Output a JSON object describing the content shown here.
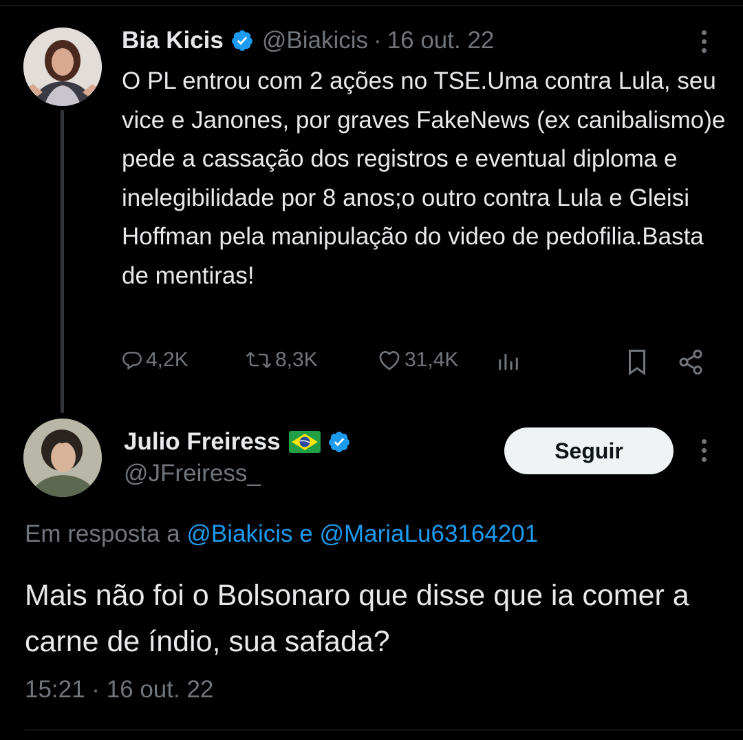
{
  "tweet": {
    "author": {
      "name": "Bia Kicis",
      "handle": "@Biakicis",
      "verified": true
    },
    "date": "16 out. 22",
    "separator": "·",
    "text": "O PL entrou com 2 ações no TSE.Uma contra Lula, seu vice e Janones, por graves FakeNews (ex canibalismo)e pede a cassação dos registros e eventual diploma e inelegibilidade por 8 anos;o outro contra Lula e Gleisi Hoffman pela manipulação do video de pedofilia.Basta de mentiras!",
    "metrics": {
      "replies": "4,2K",
      "retweets": "8,3K",
      "likes": "31,4K"
    },
    "icons": [
      "reply-icon",
      "retweet-icon",
      "like-icon",
      "views-icon",
      "bookmark-icon",
      "share-icon"
    ]
  },
  "reply": {
    "author": {
      "name": "Julio Freiress",
      "handle": "@JFreiress_",
      "verified": true,
      "flag": "brazil-flag-icon"
    },
    "follow_label": "Seguir",
    "reply_to_prefix": "Em resposta a",
    "reply_to_mention_1": "@Biakicis",
    "reply_to_conjunction": "e",
    "reply_to_mention_2": "@MariaLu63164201",
    "text": "Mais não foi o Bolsonaro que disse que ia comer a carne de índio, sua safada?",
    "timestamp": "15:21 · 16 out. 22"
  },
  "colors": {
    "background": "#000000",
    "text": "#e7e9ea",
    "muted": "#71767b",
    "accent": "#1d9bf0",
    "button_bg": "#eff3f4"
  }
}
